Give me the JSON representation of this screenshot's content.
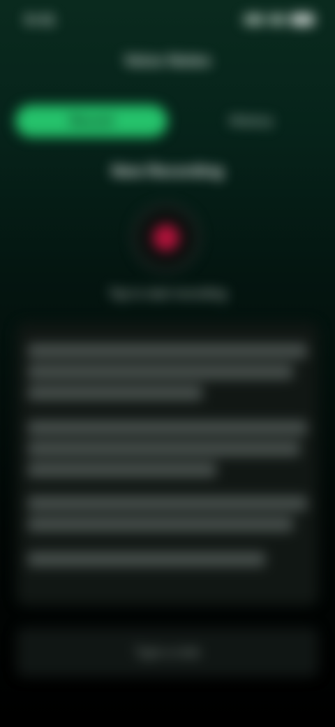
{
  "status_bar": {
    "time": "9:41"
  },
  "header": {
    "title": "Voice Notes"
  },
  "tabs": [
    {
      "label": "Record",
      "active": true
    },
    {
      "label": "History",
      "active": false
    }
  ],
  "session": {
    "title": "New Recording",
    "record_caption": "Tap to start recording"
  },
  "transcript": {
    "paragraphs": [
      "",
      "",
      "",
      ""
    ]
  },
  "bottom": {
    "placeholder": "Type a note"
  },
  "colors": {
    "accent": "#25c26b",
    "record": "#b0123a",
    "background": "#041510"
  },
  "icons": {
    "signal": "signal-icon",
    "wifi": "wifi-icon",
    "battery": "battery-icon",
    "record": "record-icon"
  }
}
